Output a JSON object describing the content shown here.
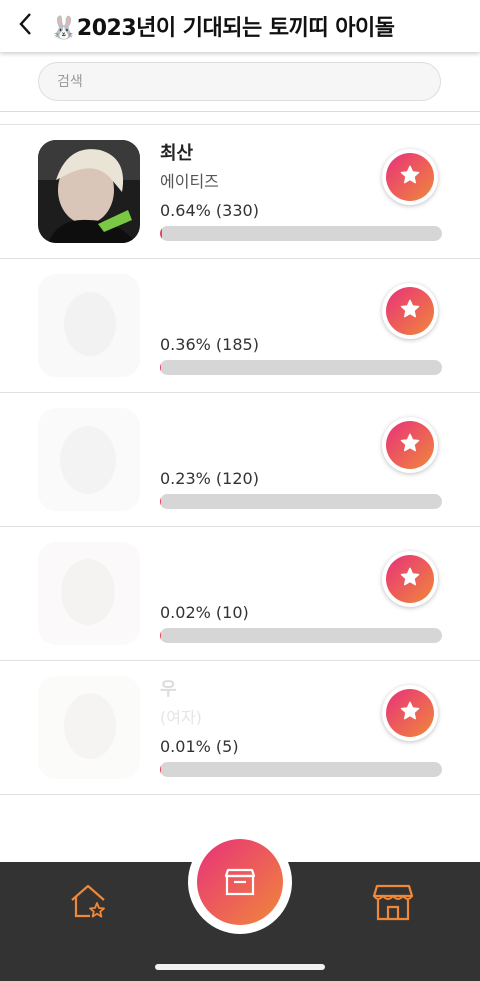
{
  "header": {
    "title": "🐰2023년이 기대되는 토끼띠 아이돌"
  },
  "search": {
    "placeholder": "검색"
  },
  "candidates": [
    {
      "name": "최산",
      "group": "에이티즈",
      "percent_text": "0.64% (330)",
      "share_percent": 0.64
    },
    {
      "name": "",
      "group": "",
      "percent_text": "0.36% (185)",
      "share_percent": 0.36
    },
    {
      "name": "",
      "group": "",
      "percent_text": "0.23% (120)",
      "share_percent": 0.23
    },
    {
      "name": "",
      "group": "",
      "percent_text": "0.02% (10)",
      "share_percent": 0.02
    },
    {
      "name": "우",
      "group": "(여자)",
      "percent_text": "0.01% (5)",
      "share_percent": 0.01
    }
  ],
  "icons": {
    "back": "chevron-left-icon",
    "vote": "star-icon",
    "home": "home-star-icon",
    "center": "ballot-box-icon",
    "shop": "store-icon"
  },
  "colors": {
    "accent_start": "#e8317a",
    "accent_end": "#f0883a",
    "bar_fill": "#e8445e",
    "nav_background": "#333333",
    "nav_icon": "#f0883a"
  }
}
